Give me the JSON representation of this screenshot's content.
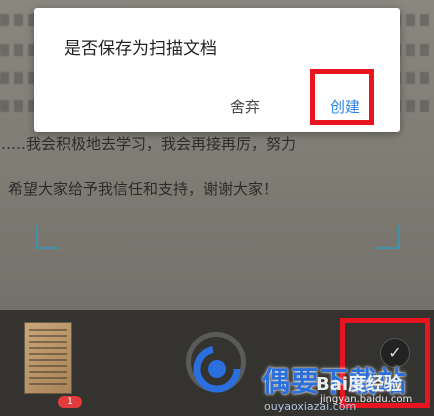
{
  "dialog": {
    "title": "是否保存为扫描文档",
    "discard_label": "舍弃",
    "create_label": "创建"
  },
  "camera": {
    "doc_line_1": "……我会积极地去学习，我会再接再厉，努力",
    "doc_line_2": "希望大家给予我信任和支持，谢谢大家！"
  },
  "thumbnail": {
    "badge_count": "1"
  },
  "watermark": {
    "brand": "偶要下载站",
    "baidu": "Bai度经验",
    "baidu_url": "jingyan.baidu.com",
    "site": "ouyaoxiazai.com"
  },
  "colors": {
    "accent": "#2a84e6",
    "highlight": "#e8141f"
  },
  "icons": {
    "confirm": "check-icon",
    "shutter": "shutter-icon"
  }
}
